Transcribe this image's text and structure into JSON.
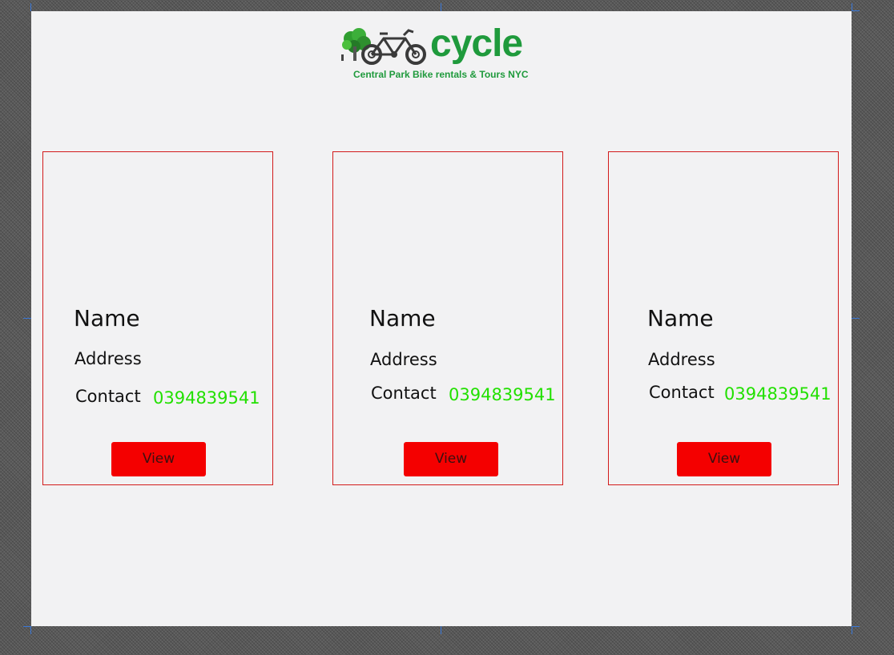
{
  "header": {
    "logo_word": "cycle",
    "logo_tagline": "Central Park Bike rentals & Tours NYC",
    "logo_icon": "bike-with-tree-icon"
  },
  "cards": [
    {
      "name": "Name",
      "address": "Address",
      "contact_label": "Contact",
      "contact_value": "0394839541",
      "button_label": "View"
    },
    {
      "name": "Name",
      "address": "Address",
      "contact_label": "Contact",
      "contact_value": "0394839541",
      "button_label": "View"
    },
    {
      "name": "Name",
      "address": "Address",
      "contact_label": "Contact",
      "contact_value": "0394839541",
      "button_label": "View"
    }
  ],
  "colors": {
    "brand_green": "#1f9a3c",
    "card_border": "#d21b1b",
    "button_bg": "#f40000",
    "contact_value": "#22e000",
    "artboard_bg": "#f2f2f3"
  }
}
